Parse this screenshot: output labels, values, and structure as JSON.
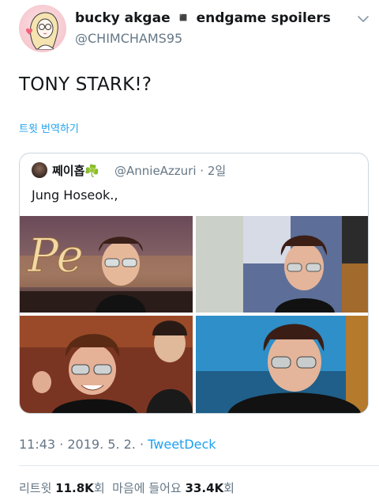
{
  "author": {
    "display_name": "bucky akgae ◾️ endgame spoilers",
    "handle": "@CHIMCHAMS95"
  },
  "tweet": {
    "text": "TONY STARK!?",
    "translate_label": "트윗 번역하기"
  },
  "quoted_tweet": {
    "name": "쩨이홉☘️",
    "handle_and_time": "@AnnieAzzuri · 2일",
    "text": "Jung Hoseok.,",
    "photos": [
      "photo-1",
      "photo-2",
      "photo-3",
      "photo-4"
    ],
    "sign_text": "Pe"
  },
  "meta": {
    "time": "11:43 · 2019. 5. 2. · ",
    "source": "TweetDeck"
  },
  "stats": {
    "retweets_label": "리트윗 ",
    "retweets_count": "11.8K",
    "retweets_unit": "회",
    "likes_label": "  마음에 들어요 ",
    "likes_count": "33.4K",
    "likes_unit": "회"
  },
  "colors": {
    "link": "#1da1f2",
    "secondary_text": "#657786",
    "border": "#ccd6dd"
  },
  "icons": {
    "chevron": "chevron-down-icon"
  }
}
